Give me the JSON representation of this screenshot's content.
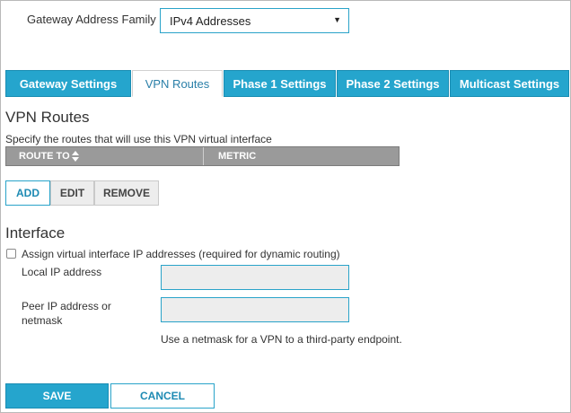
{
  "gateway": {
    "label": "Gateway Address Family",
    "selected": "IPv4 Addresses"
  },
  "tabs": [
    {
      "label": "Gateway Settings",
      "active": false
    },
    {
      "label": "VPN Routes",
      "active": true
    },
    {
      "label": "Phase 1 Settings",
      "active": false
    },
    {
      "label": "Phase 2 Settings",
      "active": false
    },
    {
      "label": "Multicast Settings",
      "active": false
    }
  ],
  "routes": {
    "heading": "VPN Routes",
    "description": "Specify the routes that will use this VPN virtual interface",
    "columns": [
      "ROUTE TO",
      "METRIC"
    ],
    "buttons": {
      "add": "ADD",
      "edit": "EDIT",
      "remove": "REMOVE"
    }
  },
  "interface": {
    "heading": "Interface",
    "checkbox_label": "Assign virtual interface IP addresses (required for dynamic routing)",
    "checked": false,
    "local_label": "Local IP address",
    "local_value": "",
    "peer_label": "Peer IP address or netmask",
    "peer_value": "",
    "hint": "Use a netmask for a VPN to a third-party endpoint."
  },
  "footer": {
    "save": "SAVE",
    "cancel": "CANCEL"
  },
  "colors": {
    "accent": "#25a5cd",
    "header_gray": "#9a9a9a",
    "input_bg": "#ededed"
  }
}
